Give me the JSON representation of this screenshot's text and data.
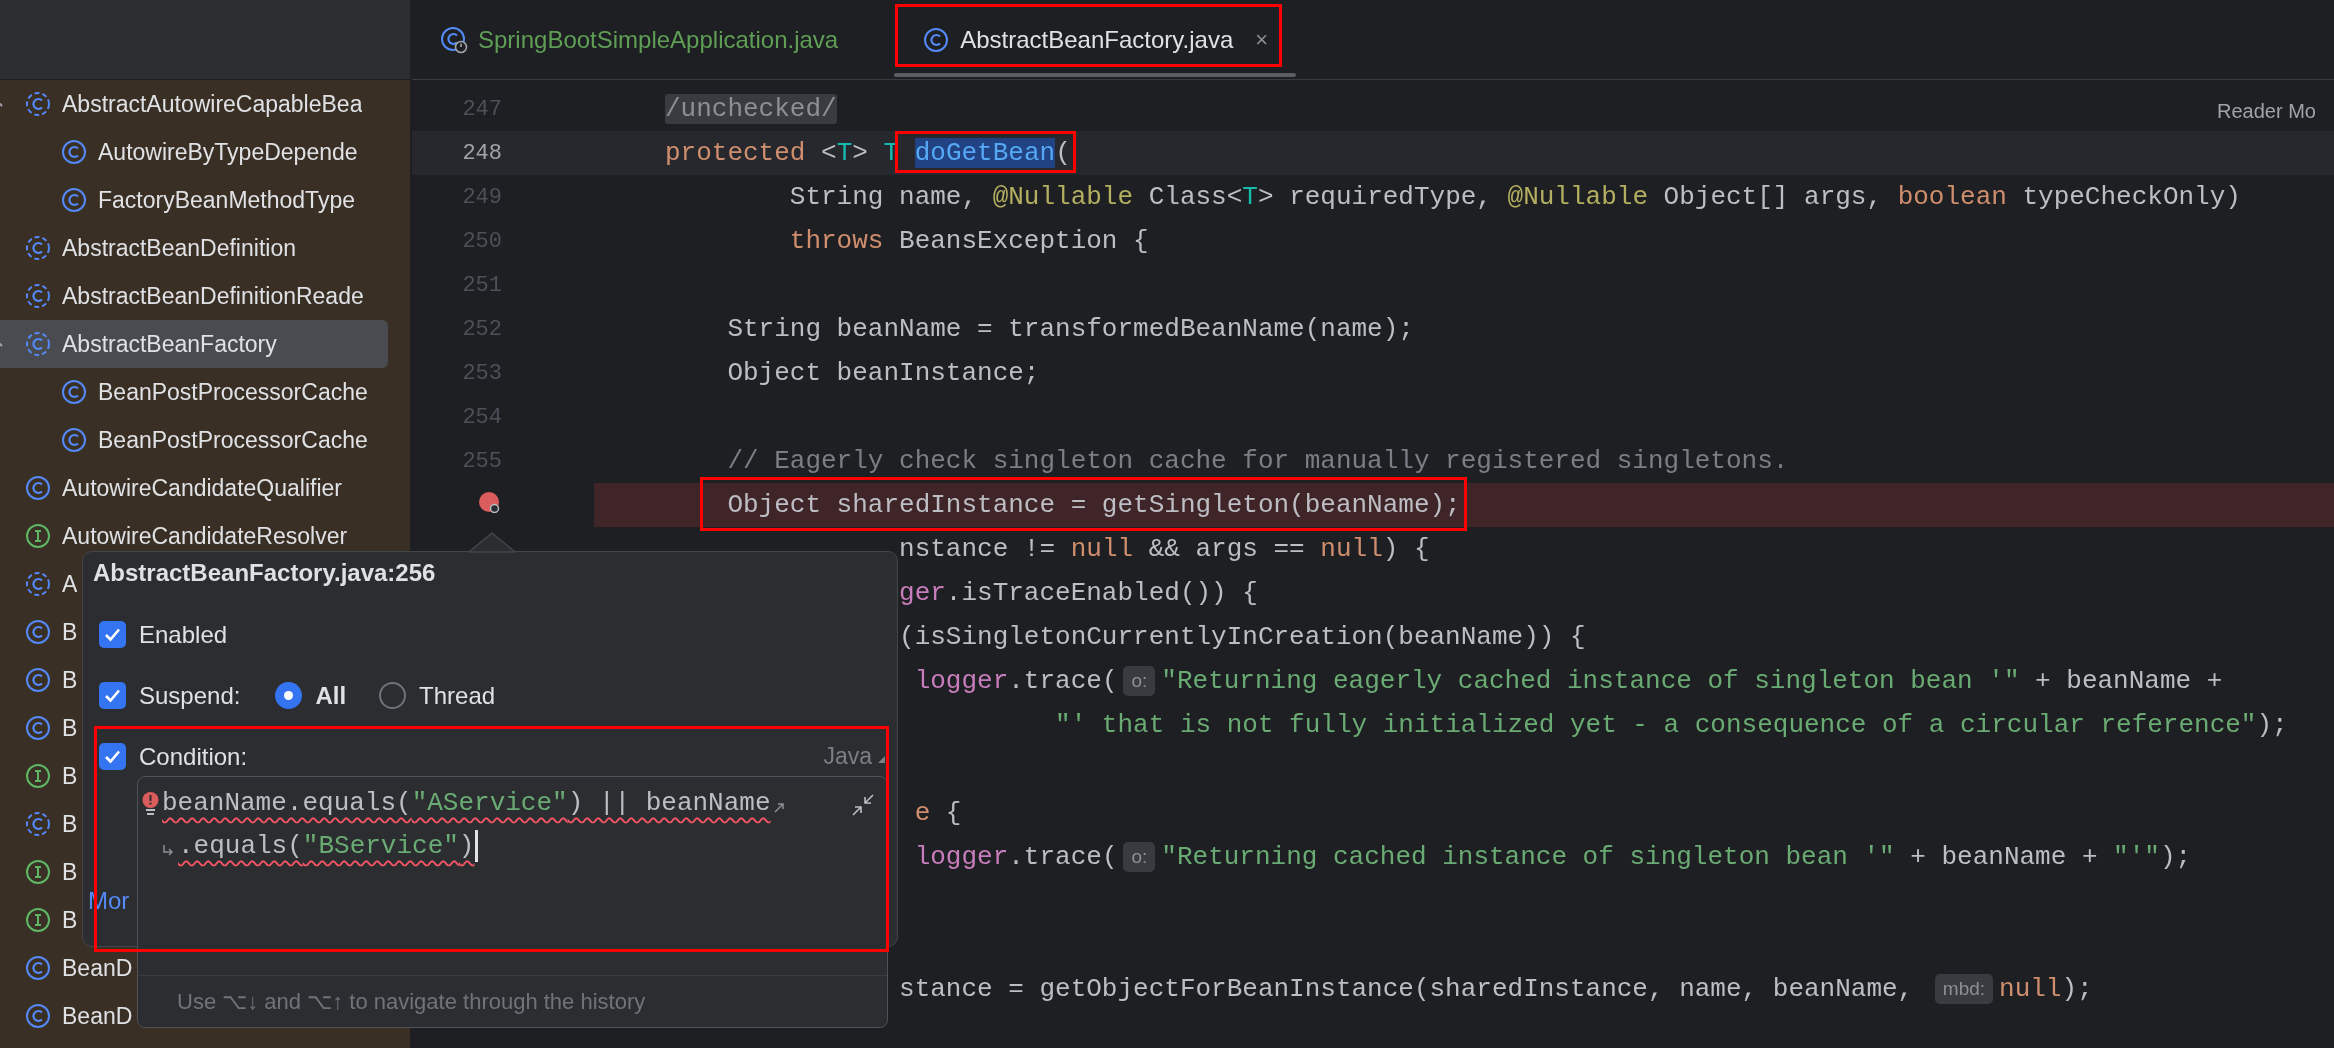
{
  "sidebar": {
    "items": [
      {
        "label": "AbstractAutowireCapableBea",
        "kind": "abstract",
        "expanded": true,
        "selected": false,
        "children": [
          {
            "label": "AutowireByTypeDepende",
            "kind": "class",
            "selected": false
          },
          {
            "label": "FactoryBeanMethodType",
            "kind": "class",
            "selected": false
          }
        ]
      },
      {
        "label": "AbstractBeanDefinition",
        "kind": "abstract",
        "selected": false
      },
      {
        "label": "AbstractBeanDefinitionReade",
        "kind": "abstract",
        "selected": false
      },
      {
        "label": "AbstractBeanFactory",
        "kind": "abstract",
        "expanded": true,
        "selected": true,
        "children": [
          {
            "label": "BeanPostProcessorCache",
            "kind": "class",
            "selected": false
          },
          {
            "label": "BeanPostProcessorCache",
            "kind": "class",
            "selected": false
          }
        ]
      },
      {
        "label": "AutowireCandidateQualifier",
        "kind": "class",
        "selected": false
      },
      {
        "label": "AutowireCandidateResolver",
        "kind": "interface",
        "selected": false
      },
      {
        "label": "A",
        "kind": "abstract",
        "selected": false
      },
      {
        "label": "B",
        "kind": "class",
        "selected": false
      },
      {
        "label": "B",
        "kind": "class",
        "selected": false
      },
      {
        "label": "B",
        "kind": "class",
        "selected": false
      },
      {
        "label": "B",
        "kind": "interface",
        "selected": false
      },
      {
        "label": "B",
        "kind": "abstract",
        "selected": false
      },
      {
        "label": "B",
        "kind": "interface",
        "selected": false
      },
      {
        "label": "B",
        "kind": "interface",
        "selected": false
      },
      {
        "label": "BeanD",
        "kind": "class",
        "selected": false
      },
      {
        "label": "BeanD",
        "kind": "class",
        "selected": false
      }
    ]
  },
  "tabs": [
    {
      "label": "SpringBootSimpleApplication.java",
      "kind": "spring",
      "color": "#5f9e55",
      "selected": false,
      "framed": false
    },
    {
      "label": "AbstractBeanFactory.java",
      "kind": "class",
      "color": "#dfe1e5",
      "selected": true,
      "framed": true,
      "close": "×"
    }
  ],
  "editor": {
    "reader_mode": "Reader Mo",
    "lines": [
      {
        "number": "247",
        "kind": "plain",
        "tokens": [
          {
            "kind": "folded",
            "t": "/unchecked/"
          }
        ]
      },
      {
        "number": "248",
        "kind": "current",
        "tokens": [
          {
            "kind": "kw",
            "t": "protected"
          },
          {
            "kind": "plain",
            "t": " <"
          },
          {
            "kind": "tp",
            "t": "T"
          },
          {
            "kind": "plain",
            "t": "> "
          },
          {
            "kind": "tp",
            "t": "T "
          },
          {
            "kind": "decl",
            "t": "doGetBean",
            "framed": true
          },
          {
            "kind": "plain",
            "t": "(",
            "framed": true
          }
        ]
      },
      {
        "number": "249",
        "kind": "plain",
        "tokens": [
          {
            "kind": "plain",
            "t": "        String name, "
          },
          {
            "kind": "ann",
            "t": "@Nullable"
          },
          {
            "kind": "plain",
            "t": " Class<"
          },
          {
            "kind": "tp",
            "t": "T"
          },
          {
            "kind": "plain",
            "t": "> requiredType, "
          },
          {
            "kind": "ann",
            "t": "@Nullable"
          },
          {
            "kind": "plain",
            "t": " Object[] args, "
          },
          {
            "kind": "kw",
            "t": "boolean"
          },
          {
            "kind": "plain",
            "t": " typeCheckOnly)"
          }
        ]
      },
      {
        "number": "250",
        "kind": "plain",
        "tokens": [
          {
            "kind": "kw",
            "t": "        throws"
          },
          {
            "kind": "plain",
            "t": " BeansException {"
          }
        ]
      },
      {
        "number": "251",
        "kind": "plain"
      },
      {
        "number": "252",
        "kind": "plain",
        "tokens": [
          {
            "kind": "plain",
            "t": "    String beanName = transformedBeanName(name);"
          }
        ]
      },
      {
        "number": "253",
        "kind": "plain",
        "tokens": [
          {
            "kind": "plain",
            "t": "    Object beanInstance;"
          }
        ]
      },
      {
        "number": "254",
        "kind": "plain"
      },
      {
        "number": "255",
        "kind": "plain",
        "tokens": [
          {
            "kind": "comment",
            "t": "    // Eagerly check singleton cache for manually registered singletons."
          }
        ]
      },
      {
        "kind": "breakpoint",
        "framed": true,
        "tokens": [
          {
            "kind": "plain",
            "t": "    Object sharedInstance = getSingleton(beanName);"
          }
        ]
      },
      {
        "kind": "plain",
        "tokens": [
          {
            "kind": "plain",
            "t": "               nstance != "
          },
          {
            "kind": "kw",
            "t": "null"
          },
          {
            "kind": "plain",
            "t": " && args == "
          },
          {
            "kind": "kw",
            "t": "null"
          },
          {
            "kind": "plain",
            "t": ") {"
          }
        ]
      },
      {
        "kind": "plain",
        "tokens": [
          {
            "kind": "field",
            "t": "               ger"
          },
          {
            "kind": "plain",
            "t": ".isTraceEnabled()) {"
          }
        ]
      },
      {
        "kind": "plain",
        "tokens": [
          {
            "kind": "plain",
            "t": "               (isSingletonCurrentlyInCreation(beanName)) {"
          }
        ]
      },
      {
        "kind": "plain",
        "tokens": [
          {
            "kind": "field",
            "t": "                logger"
          },
          {
            "kind": "plain",
            "t": ".trace("
          },
          {
            "kind": "hint",
            "t": "o:"
          },
          {
            "kind": "str",
            "t": "\"Returning eagerly cached instance of singleton bean '\""
          },
          {
            "kind": "plain",
            "t": " + beanName +"
          }
        ]
      },
      {
        "kind": "plain",
        "tokens": [
          {
            "kind": "str",
            "t": "                         \"' that is not fully initialized yet - a consequence of a circular reference\""
          },
          {
            "kind": "plain",
            "t": ");"
          }
        ]
      },
      {
        "kind": "plain"
      },
      {
        "kind": "plain",
        "tokens": [
          {
            "kind": "kw",
            "t": "                e"
          },
          {
            "kind": "plain",
            "t": " {"
          }
        ]
      },
      {
        "kind": "plain",
        "tokens": [
          {
            "kind": "field",
            "t": "                logger"
          },
          {
            "kind": "plain",
            "t": ".trace("
          },
          {
            "kind": "hint",
            "t": "o:"
          },
          {
            "kind": "str",
            "t": "\"Returning cached instance of singleton bean '\""
          },
          {
            "kind": "plain",
            "t": " + beanName + "
          },
          {
            "kind": "str",
            "t": "\"'\""
          },
          {
            "kind": "plain",
            "t": ");"
          }
        ]
      },
      {
        "kind": "plain"
      },
      {
        "kind": "plain"
      },
      {
        "kind": "plain",
        "tokens": [
          {
            "kind": "plain",
            "t": "               stance = getObjectForBeanInstance(sharedInstance, name, beanName, "
          },
          {
            "kind": "hint",
            "t": "mbd:"
          },
          {
            "kind": "kw",
            "t": "null"
          },
          {
            "kind": "plain",
            "t": ");"
          }
        ]
      }
    ]
  },
  "breakpoint_popup": {
    "title": "AbstractBeanFactory.java:256",
    "enabled": {
      "label": "Enabled",
      "checked": true
    },
    "suspend": {
      "label": "Suspend:",
      "checked": true,
      "options": [
        {
          "label": "All",
          "selected": true
        },
        {
          "label": "Thread",
          "selected": false
        }
      ]
    },
    "condition": {
      "label": "Condition:",
      "checked": true,
      "language": "Java",
      "framed": true,
      "error": true,
      "soft_wrap": true,
      "cursor": true,
      "lines": [
        [
          {
            "kind": "plain",
            "t": "beanName.equals("
          },
          {
            "kind": "str",
            "t": "\"AService\""
          },
          {
            "kind": "plain",
            "t": ") || beanName"
          }
        ],
        [
          {
            "kind": "plain",
            "t": ".equals("
          },
          {
            "kind": "str",
            "t": "\"BService\""
          },
          {
            "kind": "plain",
            "t": ")"
          }
        ]
      ],
      "hint": "Use ⌥↓ and ⌥↑ to navigate through the history"
    },
    "more_link": "Mor"
  }
}
